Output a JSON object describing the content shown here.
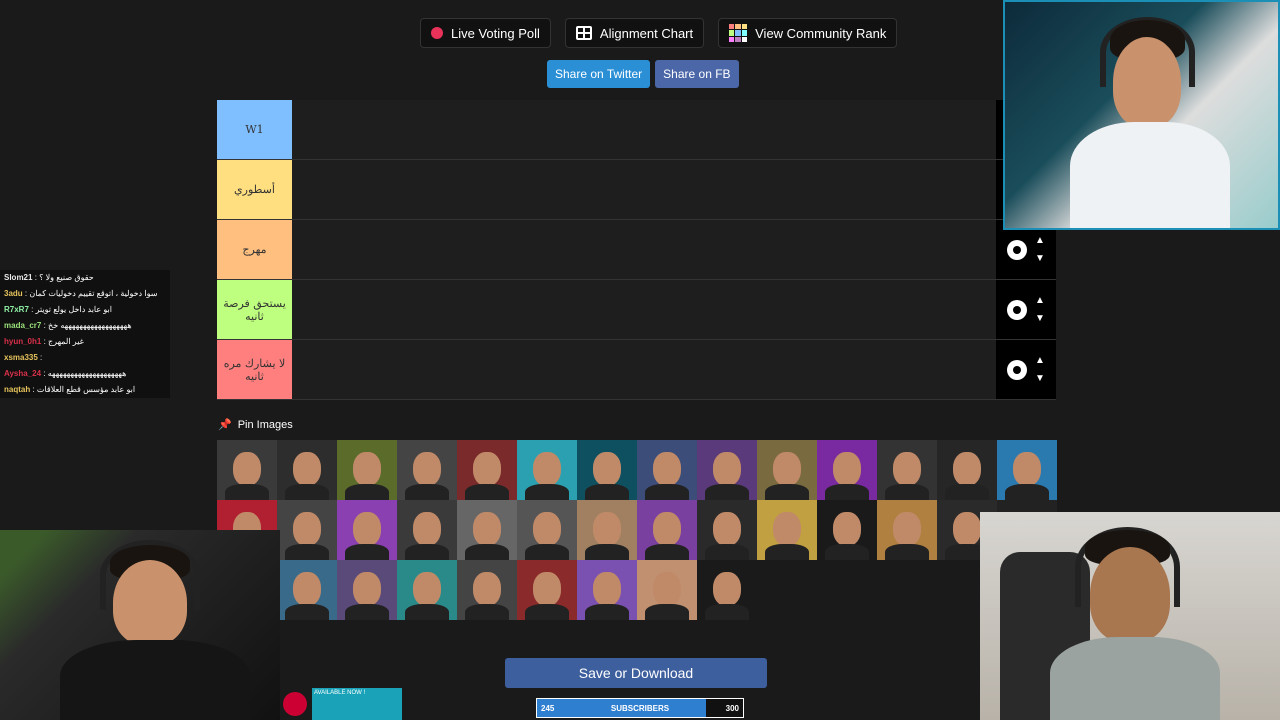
{
  "toolbar": {
    "live_voting": "Live Voting Poll",
    "alignment_chart": "Alignment Chart",
    "community_rank": "View Community Rank"
  },
  "share": {
    "twitter": "Share on Twitter",
    "fb": "Share on FB"
  },
  "tiers": [
    {
      "label": "W1",
      "color": "#7fbfff"
    },
    {
      "label": "أسطوري",
      "color": "#ffdf80"
    },
    {
      "label": "مهرج",
      "color": "#ffbf7f"
    },
    {
      "label": "يستحق فرصة ثانيه",
      "color": "#bfff7f"
    },
    {
      "label": "لا يشارك مره ثانيه",
      "color": "#ff7f7f"
    }
  ],
  "pin_images": "Pin Images",
  "save_button": "Save or Download",
  "subscribers": {
    "current": "245",
    "label": "SUBSCRIBERS",
    "goal": "300",
    "progress": 0.82
  },
  "chat": [
    {
      "user": "Slom21",
      "color": "#e8e8e8",
      "text": "حقوق صنيع ولا ؟"
    },
    {
      "user": "3adu",
      "color": "#e6c35c",
      "text": "سوا دخولية ، اتوقع تقييم دخوليات كمان"
    },
    {
      "user": "R7xR7",
      "color": "#8ff0a4",
      "text": "ابو عابد داخل يولع تويتر"
    },
    {
      "user": "mada_cr7",
      "color": "#9ae07a",
      "text": "ههههههههههههههههههه خخ"
    },
    {
      "user": "hyun_0h1",
      "color": "#d9304a",
      "text": "غير المهرج"
    },
    {
      "user": "xsma335",
      "color": "#e6c35c",
      "text": ""
    },
    {
      "user": "Aysha_24",
      "color": "#d9304a",
      "text": "ههههههههههههههههههههه"
    },
    {
      "user": "naqtah",
      "color": "#e6c35c",
      "text": "ابو عابد مؤسس قطع العلاقات"
    }
  ],
  "banner_text": "AVAILABLE NOW !"
}
